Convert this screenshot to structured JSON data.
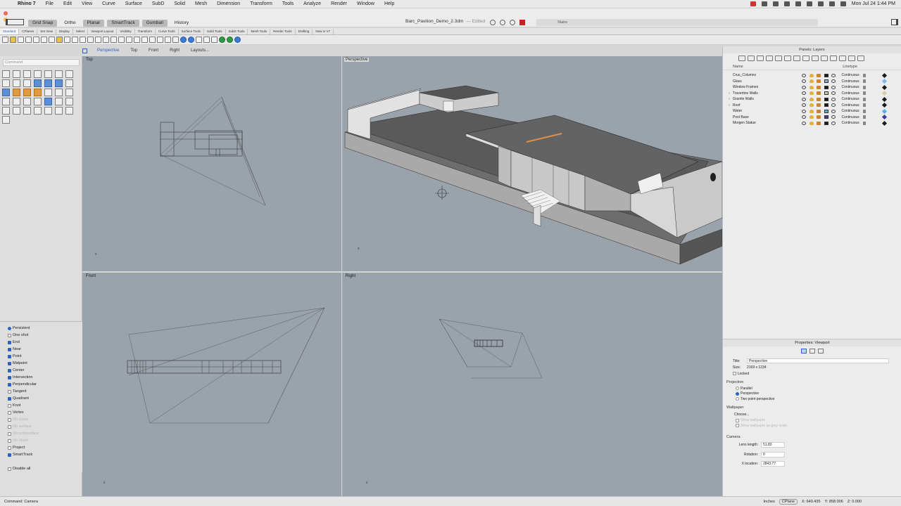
{
  "menubar": {
    "app": "Rhino 7",
    "items": [
      "File",
      "Edit",
      "View",
      "Curve",
      "Surface",
      "SubD",
      "Solid",
      "Mesh",
      "Dimension",
      "Transform",
      "Tools",
      "Analyze",
      "Render",
      "Window",
      "Help"
    ],
    "clock": "Mon Jul 24  1:44 PM"
  },
  "titlebar": {
    "document": "Barc_Pavilion_Demo_2.3dm",
    "edited": "— Edited",
    "toggles": [
      "Grid Snap",
      "Ortho",
      "Planar",
      "SmartTrack",
      "Gumball",
      "History"
    ],
    "layer_field": "Stairs"
  },
  "tabs": [
    "Standard",
    "CPlanes",
    "Set View",
    "Display",
    "Select",
    "Viewport Layout",
    "Visibility",
    "Transform",
    "Curve Tools",
    "Surface Tools",
    "Solid Tools",
    "SubD Tools",
    "Mesh Tools",
    "Render Tools",
    "Drafting",
    "New in V7"
  ],
  "viewport_tabs": [
    "Perspective",
    "Top",
    "Front",
    "Right",
    "Layouts..."
  ],
  "command": {
    "placeholder": "Command",
    "status": "Command: Camera"
  },
  "viewports": {
    "top": "Top",
    "perspective": "Perspective",
    "front": "Front",
    "right": "Right"
  },
  "osnaps": [
    {
      "label": "Persistent",
      "state": "radio"
    },
    {
      "label": "One shot",
      "state": "off"
    },
    {
      "label": "End",
      "state": "on"
    },
    {
      "label": "Near",
      "state": "on"
    },
    {
      "label": "Point",
      "state": "on"
    },
    {
      "label": "Midpoint",
      "state": "on"
    },
    {
      "label": "Center",
      "state": "on"
    },
    {
      "label": "Intersection",
      "state": "on"
    },
    {
      "label": "Perpendicular",
      "state": "on"
    },
    {
      "label": "Tangent",
      "state": "off"
    },
    {
      "label": "Quadrant",
      "state": "on"
    },
    {
      "label": "Knot",
      "state": "off"
    },
    {
      "label": "Vertex",
      "state": "off"
    },
    {
      "label": "On curve",
      "state": "disabled"
    },
    {
      "label": "On surface",
      "state": "disabled"
    },
    {
      "label": "On polysurface",
      "state": "disabled"
    },
    {
      "label": "On mesh",
      "state": "disabled"
    },
    {
      "label": "Project",
      "state": "off"
    },
    {
      "label": "SmartTrack",
      "state": "on"
    },
    {
      "label": "",
      "state": "blank"
    },
    {
      "label": "Disable all",
      "state": "off"
    }
  ],
  "layers_panel": {
    "title": "Panels: Layers",
    "col_name": "Name",
    "col_linetype": "Linetype",
    "layers": [
      {
        "name": "Crus_Columns",
        "linetype": "Continuous",
        "color": "#1a1a1a",
        "expand": ""
      },
      {
        "name": "Glass",
        "linetype": "Continuous",
        "color": "#7fb4e6",
        "expand": ""
      },
      {
        "name": "Window Frames",
        "linetype": "Continuous",
        "color": "#1a1a1a",
        "expand": ""
      },
      {
        "name": "Travertine Walls",
        "linetype": "Continuous",
        "color": "#d9c9a6",
        "expand": "›"
      },
      {
        "name": "Granite Walls",
        "linetype": "Continuous",
        "color": "#1a1a1a",
        "expand": "›"
      },
      {
        "name": "Roof",
        "linetype": "Continuous",
        "color": "#1a1a1a",
        "expand": "›"
      },
      {
        "name": "Water",
        "linetype": "Continuous",
        "color": "#4fb3e0",
        "expand": ""
      },
      {
        "name": "Pool Base",
        "linetype": "Continuous",
        "color": "#3a3aa0",
        "expand": ""
      },
      {
        "name": "Morgen Statue",
        "linetype": "Continuous",
        "color": "#1a1a1a",
        "expand": ""
      }
    ]
  },
  "properties": {
    "title": "Properties: Viewport",
    "title_label": "Title:",
    "title_value": "Perspective",
    "size_label": "Size:",
    "size_value": "2169 x 1234",
    "locked": "Locked",
    "projection_header": "Projection",
    "projections": [
      {
        "label": "Parallel",
        "selected": false
      },
      {
        "label": "Perspective",
        "selected": true
      },
      {
        "label": "Two point perspective",
        "selected": false
      }
    ],
    "wallpaper_header": "Wallpaper",
    "choose": "Choose...",
    "show_wallpaper": "Show wallpaper",
    "show_gray": "Show wallpaper as gray scale",
    "camera_header": "Camera",
    "lens_label": "Lens length:",
    "lens_value": "51.83",
    "rotation_label": "Rotation:",
    "rotation_value": "0",
    "xloc_label": "X location:",
    "xloc_value": "2843.77"
  },
  "statusbar": {
    "units": "Inches",
    "cplane": "CPlane",
    "x": "X: 640.435",
    "y": "Y: 858.006",
    "z": "Z: 0.000"
  }
}
